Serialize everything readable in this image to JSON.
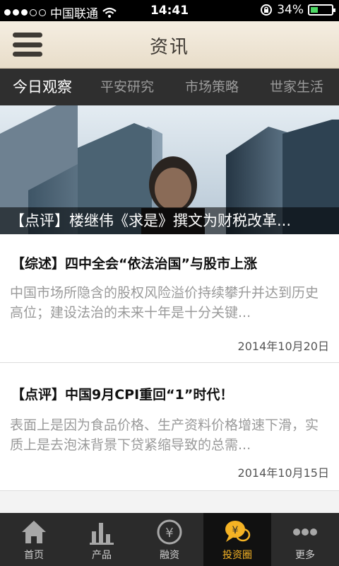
{
  "status": {
    "carrier": "中国联通",
    "time": "14:41",
    "battery": "34%",
    "battery_level": 0.34
  },
  "header": {
    "title": "资讯"
  },
  "tabs": [
    {
      "label": "今日观察",
      "active": true
    },
    {
      "label": "平安研究",
      "active": false
    },
    {
      "label": "市场策略",
      "active": false
    },
    {
      "label": "世家生活",
      "active": false
    }
  ],
  "banner": {
    "caption": "【点评】楼继伟《求是》撰文为财税改革..."
  },
  "articles": [
    {
      "headline": "【综述】四中全会“依法治国”与股市上涨",
      "summary": "中国市场所隐含的股权风险溢价持续攀升并达到历史高位；建设法治的未来十年是十分关键...",
      "date": "2014年10月20日"
    },
    {
      "headline": "【点评】中国9月CPI重回“1”时代！",
      "summary": "表面上是因为食品价格、生产资料价格增速下滑，实质上是去泡沫背景下贷紧缩导致的总需...",
      "date": "2014年10月15日"
    }
  ],
  "tabbar": [
    {
      "label": "首页",
      "icon": "home-icon",
      "active": false
    },
    {
      "label": "产品",
      "icon": "product-chart-icon",
      "active": false
    },
    {
      "label": "融资",
      "icon": "yen-icon",
      "active": false
    },
    {
      "label": "投资圈",
      "icon": "chat-yen-icon",
      "active": true
    },
    {
      "label": "更多",
      "icon": "more-icon",
      "active": false
    }
  ],
  "colors": {
    "accent": "#f5b324",
    "header_bg": "#efe6d6",
    "tab_bg": "#2f2f2f"
  }
}
